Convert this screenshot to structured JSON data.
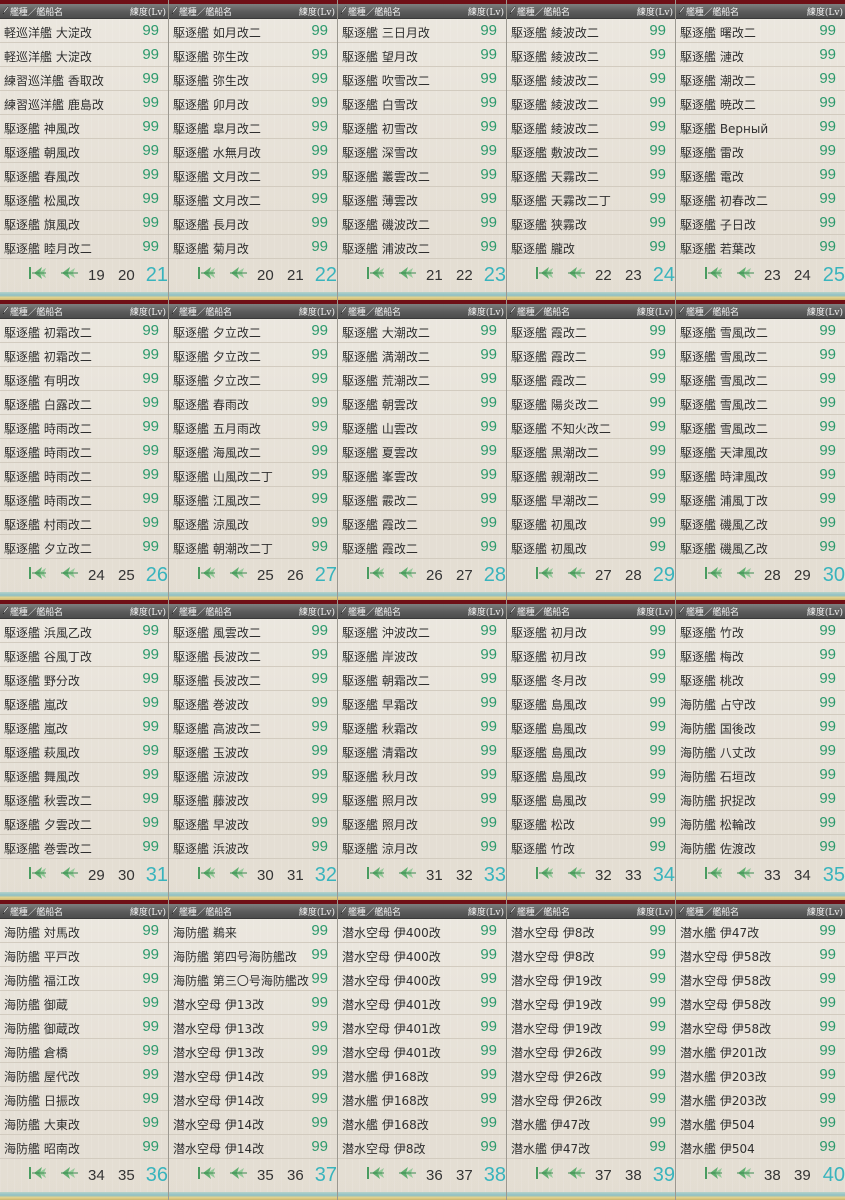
{
  "header": {
    "name_col": "艦種／艦船名",
    "lv_col": "練度(Lv)"
  },
  "icons": {
    "first": "first-page-icon",
    "prev": "prev-page-icon",
    "pen": "pen-icon"
  },
  "colors": {
    "level": "#2d9a6d",
    "current_page": "#39b4bd",
    "top_line": "#6f0f16"
  },
  "panels": [
    {
      "rows": [
        {
          "name": "軽巡洋艦 大淀改",
          "lv": "99"
        },
        {
          "name": "軽巡洋艦 大淀改",
          "lv": "99"
        },
        {
          "name": "練習巡洋艦 香取改",
          "lv": "99"
        },
        {
          "name": "練習巡洋艦 鹿島改",
          "lv": "99"
        },
        {
          "name": "駆逐艦 神風改",
          "lv": "99"
        },
        {
          "name": "駆逐艦 朝風改",
          "lv": "99"
        },
        {
          "name": "駆逐艦 春風改",
          "lv": "99"
        },
        {
          "name": "駆逐艦 松風改",
          "lv": "99"
        },
        {
          "name": "駆逐艦 旗風改",
          "lv": "99"
        },
        {
          "name": "駆逐艦 睦月改二",
          "lv": "99"
        }
      ],
      "pages": [
        "19",
        "20"
      ],
      "current": "21"
    },
    {
      "rows": [
        {
          "name": "駆逐艦 如月改二",
          "lv": "99"
        },
        {
          "name": "駆逐艦 弥生改",
          "lv": "99"
        },
        {
          "name": "駆逐艦 弥生改",
          "lv": "99"
        },
        {
          "name": "駆逐艦 卯月改",
          "lv": "99"
        },
        {
          "name": "駆逐艦 皐月改二",
          "lv": "99"
        },
        {
          "name": "駆逐艦 水無月改",
          "lv": "99"
        },
        {
          "name": "駆逐艦 文月改二",
          "lv": "99"
        },
        {
          "name": "駆逐艦 文月改二",
          "lv": "99"
        },
        {
          "name": "駆逐艦 長月改",
          "lv": "99"
        },
        {
          "name": "駆逐艦 菊月改",
          "lv": "99"
        }
      ],
      "pages": [
        "20",
        "21"
      ],
      "current": "22"
    },
    {
      "rows": [
        {
          "name": "駆逐艦 三日月改",
          "lv": "99"
        },
        {
          "name": "駆逐艦 望月改",
          "lv": "99"
        },
        {
          "name": "駆逐艦 吹雪改二",
          "lv": "99"
        },
        {
          "name": "駆逐艦 白雪改",
          "lv": "99"
        },
        {
          "name": "駆逐艦 初雪改",
          "lv": "99"
        },
        {
          "name": "駆逐艦 深雪改",
          "lv": "99"
        },
        {
          "name": "駆逐艦 叢雲改二",
          "lv": "99"
        },
        {
          "name": "駆逐艦 薄雲改",
          "lv": "99"
        },
        {
          "name": "駆逐艦 磯波改二",
          "lv": "99"
        },
        {
          "name": "駆逐艦 浦波改二",
          "lv": "99"
        }
      ],
      "pages": [
        "21",
        "22"
      ],
      "current": "23"
    },
    {
      "rows": [
        {
          "name": "駆逐艦 綾波改二",
          "lv": "99"
        },
        {
          "name": "駆逐艦 綾波改二",
          "lv": "99"
        },
        {
          "name": "駆逐艦 綾波改二",
          "lv": "99"
        },
        {
          "name": "駆逐艦 綾波改二",
          "lv": "99"
        },
        {
          "name": "駆逐艦 綾波改二",
          "lv": "99"
        },
        {
          "name": "駆逐艦 敷波改二",
          "lv": "99"
        },
        {
          "name": "駆逐艦 天霧改二",
          "lv": "99"
        },
        {
          "name": "駆逐艦 天霧改二丁",
          "lv": "99"
        },
        {
          "name": "駆逐艦 狭霧改",
          "lv": "99"
        },
        {
          "name": "駆逐艦 朧改",
          "lv": "99"
        }
      ],
      "pages": [
        "22",
        "23"
      ],
      "current": "24"
    },
    {
      "rows": [
        {
          "name": "駆逐艦 曙改二",
          "lv": "99"
        },
        {
          "name": "駆逐艦 漣改",
          "lv": "99"
        },
        {
          "name": "駆逐艦 潮改二",
          "lv": "99"
        },
        {
          "name": "駆逐艦 暁改二",
          "lv": "99"
        },
        {
          "name": "駆逐艦 Верный",
          "lv": "99"
        },
        {
          "name": "駆逐艦 雷改",
          "lv": "99"
        },
        {
          "name": "駆逐艦 電改",
          "lv": "99"
        },
        {
          "name": "駆逐艦 初春改二",
          "lv": "99"
        },
        {
          "name": "駆逐艦 子日改",
          "lv": "99"
        },
        {
          "name": "駆逐艦 若葉改",
          "lv": "99"
        }
      ],
      "pages": [
        "23",
        "24"
      ],
      "current": "25"
    },
    {
      "rows": [
        {
          "name": "駆逐艦 初霜改二",
          "lv": "99"
        },
        {
          "name": "駆逐艦 初霜改二",
          "lv": "99"
        },
        {
          "name": "駆逐艦 有明改",
          "lv": "99"
        },
        {
          "name": "駆逐艦 白露改二",
          "lv": "99"
        },
        {
          "name": "駆逐艦 時雨改二",
          "lv": "99"
        },
        {
          "name": "駆逐艦 時雨改二",
          "lv": "99"
        },
        {
          "name": "駆逐艦 時雨改二",
          "lv": "99"
        },
        {
          "name": "駆逐艦 時雨改二",
          "lv": "99"
        },
        {
          "name": "駆逐艦 村雨改二",
          "lv": "99"
        },
        {
          "name": "駆逐艦 夕立改二",
          "lv": "99"
        }
      ],
      "pages": [
        "24",
        "25"
      ],
      "current": "26"
    },
    {
      "rows": [
        {
          "name": "駆逐艦 夕立改二",
          "lv": "99"
        },
        {
          "name": "駆逐艦 夕立改二",
          "lv": "99"
        },
        {
          "name": "駆逐艦 夕立改二",
          "lv": "99"
        },
        {
          "name": "駆逐艦 春雨改",
          "lv": "99"
        },
        {
          "name": "駆逐艦 五月雨改",
          "lv": "99"
        },
        {
          "name": "駆逐艦 海風改二",
          "lv": "99"
        },
        {
          "name": "駆逐艦 山風改二丁",
          "lv": "99"
        },
        {
          "name": "駆逐艦 江風改二",
          "lv": "99"
        },
        {
          "name": "駆逐艦 涼風改",
          "lv": "99"
        },
        {
          "name": "駆逐艦 朝潮改二丁",
          "lv": "99"
        }
      ],
      "pages": [
        "25",
        "26"
      ],
      "current": "27"
    },
    {
      "rows": [
        {
          "name": "駆逐艦 大潮改二",
          "lv": "99"
        },
        {
          "name": "駆逐艦 満潮改二",
          "lv": "99"
        },
        {
          "name": "駆逐艦 荒潮改二",
          "lv": "99"
        },
        {
          "name": "駆逐艦 朝雲改",
          "lv": "99"
        },
        {
          "name": "駆逐艦 山雲改",
          "lv": "99"
        },
        {
          "name": "駆逐艦 夏雲改",
          "lv": "99"
        },
        {
          "name": "駆逐艦 峯雲改",
          "lv": "99"
        },
        {
          "name": "駆逐艦 霰改二",
          "lv": "99"
        },
        {
          "name": "駆逐艦 霞改二",
          "lv": "99"
        },
        {
          "name": "駆逐艦 霞改二",
          "lv": "99"
        }
      ],
      "pages": [
        "26",
        "27"
      ],
      "current": "28"
    },
    {
      "rows": [
        {
          "name": "駆逐艦 霞改二",
          "lv": "99"
        },
        {
          "name": "駆逐艦 霞改二",
          "lv": "99"
        },
        {
          "name": "駆逐艦 霞改二",
          "lv": "99"
        },
        {
          "name": "駆逐艦 陽炎改二",
          "lv": "99"
        },
        {
          "name": "駆逐艦 不知火改二",
          "lv": "99"
        },
        {
          "name": "駆逐艦 黒潮改二",
          "lv": "99"
        },
        {
          "name": "駆逐艦 親潮改二",
          "lv": "99"
        },
        {
          "name": "駆逐艦 早潮改二",
          "lv": "99"
        },
        {
          "name": "駆逐艦 初風改",
          "lv": "99"
        },
        {
          "name": "駆逐艦 初風改",
          "lv": "99"
        }
      ],
      "pages": [
        "27",
        "28"
      ],
      "current": "29"
    },
    {
      "rows": [
        {
          "name": "駆逐艦 雪風改二",
          "lv": "99"
        },
        {
          "name": "駆逐艦 雪風改二",
          "lv": "99"
        },
        {
          "name": "駆逐艦 雪風改二",
          "lv": "99"
        },
        {
          "name": "駆逐艦 雪風改二",
          "lv": "99"
        },
        {
          "name": "駆逐艦 雪風改二",
          "lv": "99"
        },
        {
          "name": "駆逐艦 天津風改",
          "lv": "99"
        },
        {
          "name": "駆逐艦 時津風改",
          "lv": "99"
        },
        {
          "name": "駆逐艦 浦風丁改",
          "lv": "99"
        },
        {
          "name": "駆逐艦 磯風乙改",
          "lv": "99"
        },
        {
          "name": "駆逐艦 磯風乙改",
          "lv": "99"
        }
      ],
      "pages": [
        "28",
        "29"
      ],
      "current": "30"
    },
    {
      "rows": [
        {
          "name": "駆逐艦 浜風乙改",
          "lv": "99"
        },
        {
          "name": "駆逐艦 谷風丁改",
          "lv": "99"
        },
        {
          "name": "駆逐艦 野分改",
          "lv": "99"
        },
        {
          "name": "駆逐艦 嵐改",
          "lv": "99"
        },
        {
          "name": "駆逐艦 嵐改",
          "lv": "99"
        },
        {
          "name": "駆逐艦 萩風改",
          "lv": "99"
        },
        {
          "name": "駆逐艦 舞風改",
          "lv": "99"
        },
        {
          "name": "駆逐艦 秋雲改二",
          "lv": "99"
        },
        {
          "name": "駆逐艦 夕雲改二",
          "lv": "99"
        },
        {
          "name": "駆逐艦 巻雲改二",
          "lv": "99"
        }
      ],
      "pages": [
        "29",
        "30"
      ],
      "current": "31"
    },
    {
      "rows": [
        {
          "name": "駆逐艦 風雲改二",
          "lv": "99"
        },
        {
          "name": "駆逐艦 長波改二",
          "lv": "99"
        },
        {
          "name": "駆逐艦 長波改二",
          "lv": "99"
        },
        {
          "name": "駆逐艦 巻波改",
          "lv": "99"
        },
        {
          "name": "駆逐艦 高波改二",
          "lv": "99"
        },
        {
          "name": "駆逐艦 玉波改",
          "lv": "99"
        },
        {
          "name": "駆逐艦 涼波改",
          "lv": "99"
        },
        {
          "name": "駆逐艦 藤波改",
          "lv": "99"
        },
        {
          "name": "駆逐艦 早波改",
          "lv": "99"
        },
        {
          "name": "駆逐艦 浜波改",
          "lv": "99"
        }
      ],
      "pages": [
        "30",
        "31"
      ],
      "current": "32"
    },
    {
      "rows": [
        {
          "name": "駆逐艦 沖波改二",
          "lv": "99"
        },
        {
          "name": "駆逐艦 岸波改",
          "lv": "99"
        },
        {
          "name": "駆逐艦 朝霜改二",
          "lv": "99"
        },
        {
          "name": "駆逐艦 早霜改",
          "lv": "99"
        },
        {
          "name": "駆逐艦 秋霜改",
          "lv": "99"
        },
        {
          "name": "駆逐艦 清霜改",
          "lv": "99"
        },
        {
          "name": "駆逐艦 秋月改",
          "lv": "99"
        },
        {
          "name": "駆逐艦 照月改",
          "lv": "99"
        },
        {
          "name": "駆逐艦 照月改",
          "lv": "99"
        },
        {
          "name": "駆逐艦 涼月改",
          "lv": "99"
        }
      ],
      "pages": [
        "31",
        "32"
      ],
      "current": "33"
    },
    {
      "rows": [
        {
          "name": "駆逐艦 初月改",
          "lv": "99"
        },
        {
          "name": "駆逐艦 初月改",
          "lv": "99"
        },
        {
          "name": "駆逐艦 冬月改",
          "lv": "99"
        },
        {
          "name": "駆逐艦 島風改",
          "lv": "99"
        },
        {
          "name": "駆逐艦 島風改",
          "lv": "99"
        },
        {
          "name": "駆逐艦 島風改",
          "lv": "99"
        },
        {
          "name": "駆逐艦 島風改",
          "lv": "99"
        },
        {
          "name": "駆逐艦 島風改",
          "lv": "99"
        },
        {
          "name": "駆逐艦 松改",
          "lv": "99"
        },
        {
          "name": "駆逐艦 竹改",
          "lv": "99"
        }
      ],
      "pages": [
        "32",
        "33"
      ],
      "current": "34"
    },
    {
      "rows": [
        {
          "name": "駆逐艦 竹改",
          "lv": "99"
        },
        {
          "name": "駆逐艦 梅改",
          "lv": "99"
        },
        {
          "name": "駆逐艦 桃改",
          "lv": "99"
        },
        {
          "name": "海防艦 占守改",
          "lv": "99"
        },
        {
          "name": "海防艦 国後改",
          "lv": "99"
        },
        {
          "name": "海防艦 八丈改",
          "lv": "99"
        },
        {
          "name": "海防艦 石垣改",
          "lv": "99"
        },
        {
          "name": "海防艦 択捉改",
          "lv": "99"
        },
        {
          "name": "海防艦 松輪改",
          "lv": "99"
        },
        {
          "name": "海防艦 佐渡改",
          "lv": "99"
        }
      ],
      "pages": [
        "33",
        "34"
      ],
      "current": "35"
    },
    {
      "rows": [
        {
          "name": "海防艦 対馬改",
          "lv": "99"
        },
        {
          "name": "海防艦 平戸改",
          "lv": "99"
        },
        {
          "name": "海防艦 福江改",
          "lv": "99"
        },
        {
          "name": "海防艦 御蔵",
          "lv": "99"
        },
        {
          "name": "海防艦 御蔵改",
          "lv": "99"
        },
        {
          "name": "海防艦 倉橋",
          "lv": "99"
        },
        {
          "name": "海防艦 屋代改",
          "lv": "99"
        },
        {
          "name": "海防艦 日振改",
          "lv": "99"
        },
        {
          "name": "海防艦 大東改",
          "lv": "99"
        },
        {
          "name": "海防艦 昭南改",
          "lv": "99"
        }
      ],
      "pages": [
        "34",
        "35"
      ],
      "current": "36"
    },
    {
      "rows": [
        {
          "name": "海防艦 鵜来",
          "lv": "99"
        },
        {
          "name": "海防艦 第四号海防艦改",
          "lv": "99"
        },
        {
          "name": "海防艦 第三〇号海防艦改",
          "lv": "99"
        },
        {
          "name": "潜水空母 伊13改",
          "lv": "99"
        },
        {
          "name": "潜水空母 伊13改",
          "lv": "99"
        },
        {
          "name": "潜水空母 伊13改",
          "lv": "99"
        },
        {
          "name": "潜水空母 伊14改",
          "lv": "99"
        },
        {
          "name": "潜水空母 伊14改",
          "lv": "99"
        },
        {
          "name": "潜水空母 伊14改",
          "lv": "99"
        },
        {
          "name": "潜水空母 伊14改",
          "lv": "99"
        }
      ],
      "pages": [
        "35",
        "36"
      ],
      "current": "37"
    },
    {
      "rows": [
        {
          "name": "潜水空母 伊400改",
          "lv": "99"
        },
        {
          "name": "潜水空母 伊400改",
          "lv": "99"
        },
        {
          "name": "潜水空母 伊400改",
          "lv": "99"
        },
        {
          "name": "潜水空母 伊401改",
          "lv": "99"
        },
        {
          "name": "潜水空母 伊401改",
          "lv": "99"
        },
        {
          "name": "潜水空母 伊401改",
          "lv": "99"
        },
        {
          "name": "潜水艦 伊168改",
          "lv": "99"
        },
        {
          "name": "潜水艦 伊168改",
          "lv": "99"
        },
        {
          "name": "潜水艦 伊168改",
          "lv": "99"
        },
        {
          "name": "潜水空母 伊8改",
          "lv": "99"
        }
      ],
      "pages": [
        "36",
        "37"
      ],
      "current": "38"
    },
    {
      "rows": [
        {
          "name": "潜水空母 伊8改",
          "lv": "99"
        },
        {
          "name": "潜水空母 伊8改",
          "lv": "99"
        },
        {
          "name": "潜水空母 伊19改",
          "lv": "99"
        },
        {
          "name": "潜水空母 伊19改",
          "lv": "99"
        },
        {
          "name": "潜水空母 伊19改",
          "lv": "99"
        },
        {
          "name": "潜水空母 伊26改",
          "lv": "99"
        },
        {
          "name": "潜水空母 伊26改",
          "lv": "99"
        },
        {
          "name": "潜水空母 伊26改",
          "lv": "99"
        },
        {
          "name": "潜水艦 伊47改",
          "lv": "99"
        },
        {
          "name": "潜水艦 伊47改",
          "lv": "99"
        }
      ],
      "pages": [
        "37",
        "38"
      ],
      "current": "39"
    },
    {
      "rows": [
        {
          "name": "潜水艦 伊47改",
          "lv": "99"
        },
        {
          "name": "潜水空母 伊58改",
          "lv": "99"
        },
        {
          "name": "潜水空母 伊58改",
          "lv": "99"
        },
        {
          "name": "潜水空母 伊58改",
          "lv": "99"
        },
        {
          "name": "潜水空母 伊58改",
          "lv": "99"
        },
        {
          "name": "潜水艦 伊201改",
          "lv": "99"
        },
        {
          "name": "潜水艦 伊203改",
          "lv": "99"
        },
        {
          "name": "潜水艦 伊203改",
          "lv": "99"
        },
        {
          "name": "潜水艦 伊504",
          "lv": "99"
        },
        {
          "name": "潜水艦 伊504",
          "lv": "99"
        }
      ],
      "pages": [
        "38",
        "39"
      ],
      "current": "40"
    }
  ]
}
